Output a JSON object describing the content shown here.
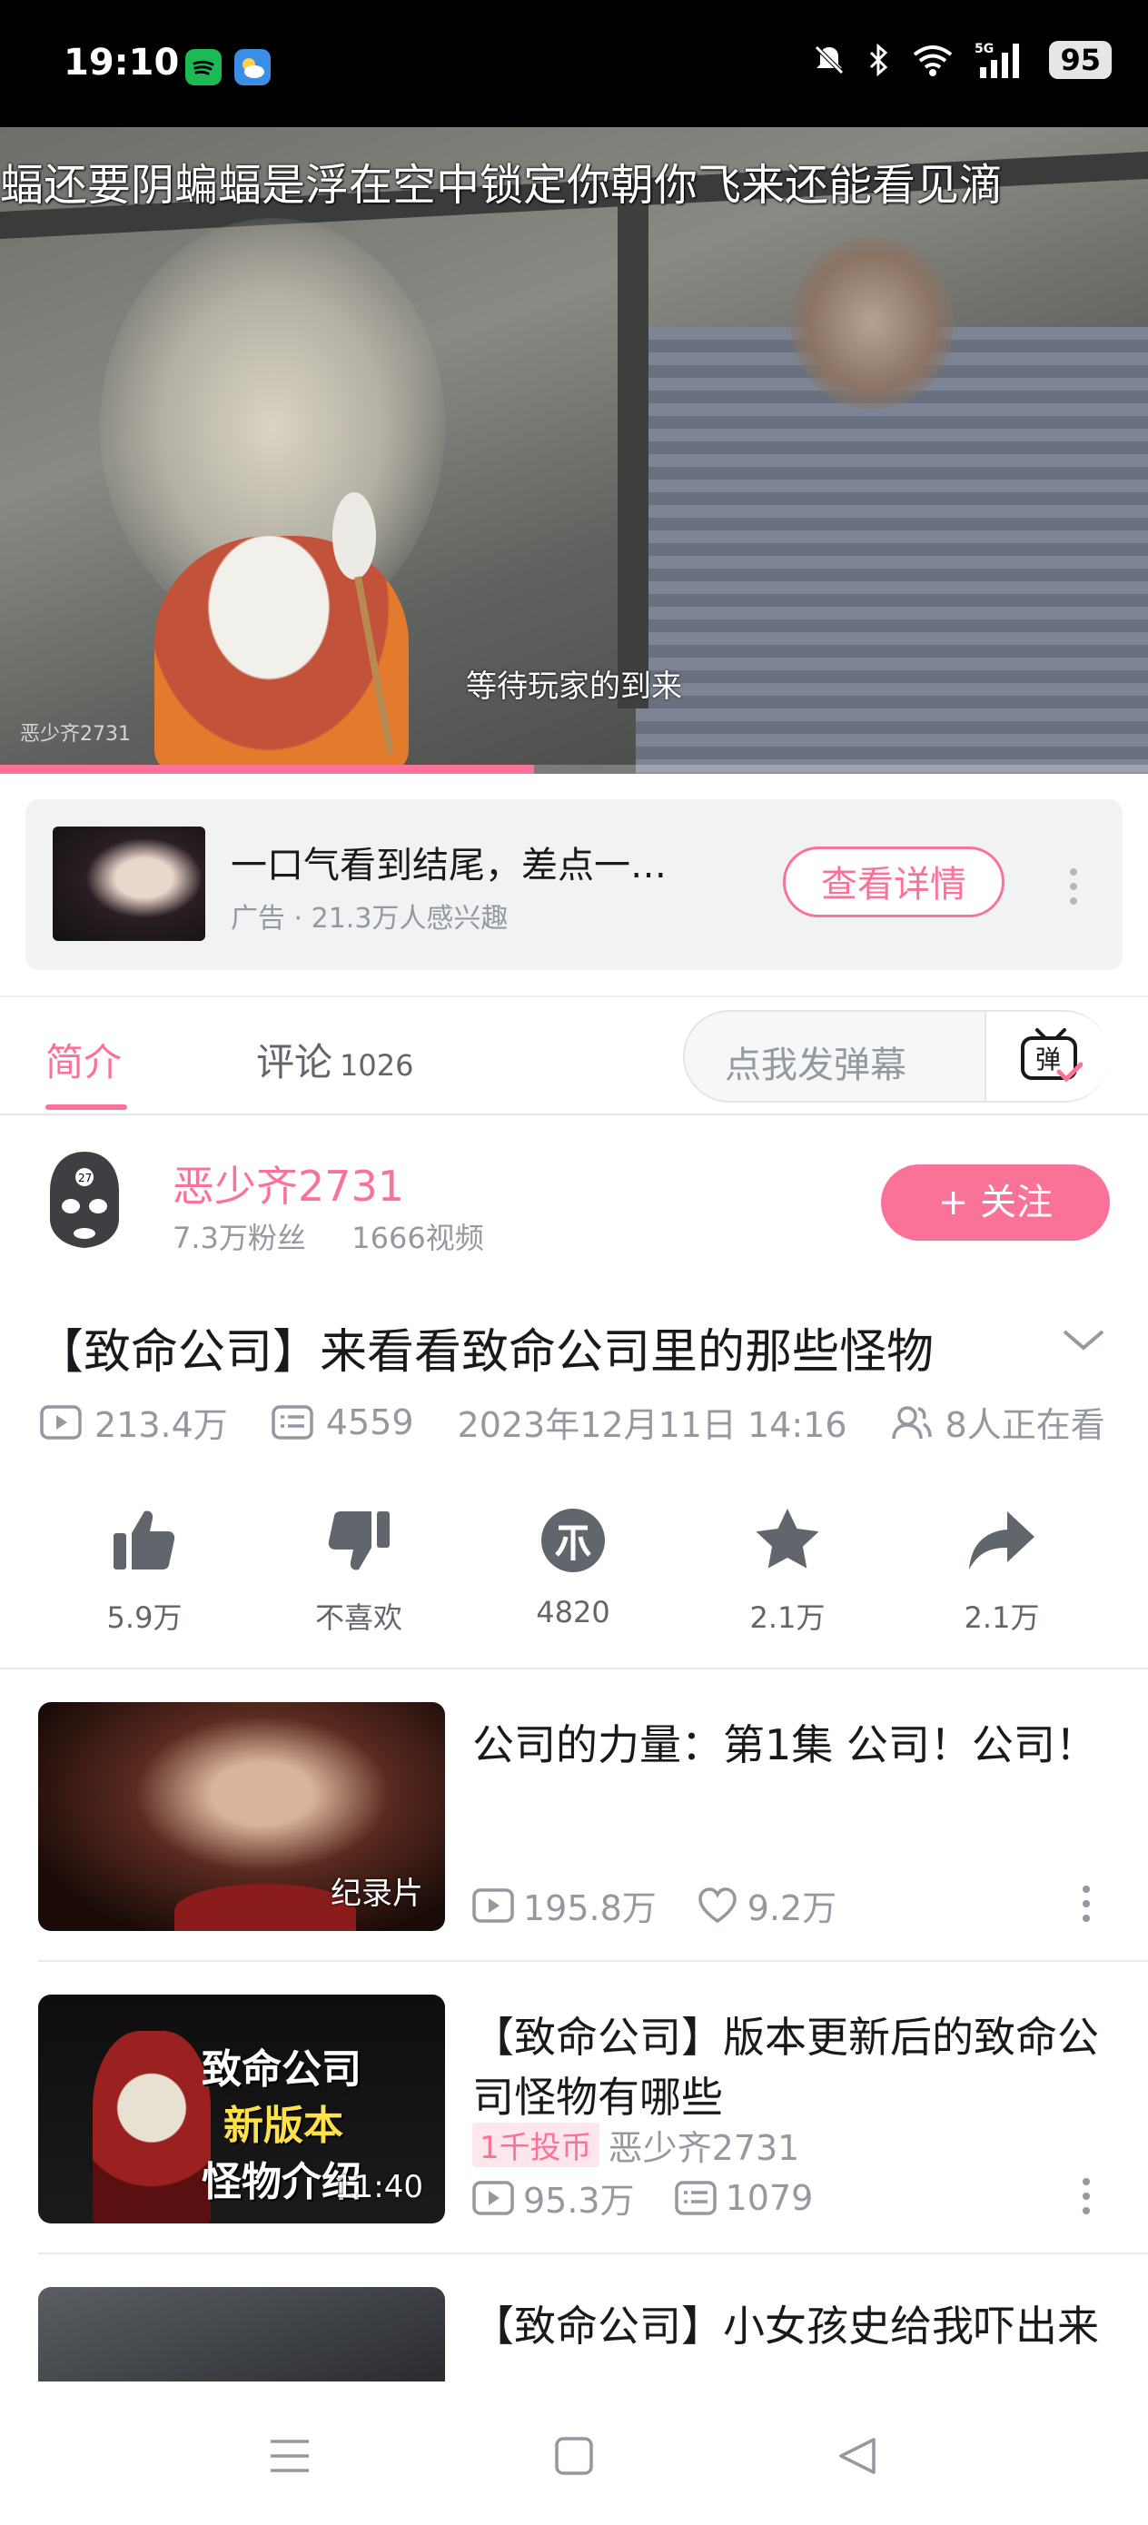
{
  "status_bar": {
    "time": "19:10",
    "battery": "95",
    "network": "5G"
  },
  "video": {
    "danmaku": "蝠还要阴蝙蝠是浮在空中锁定你朝你飞来还能看见滴",
    "subtitle": "等待玩家的到来",
    "watermark": "恶少齐2731",
    "progress": 0.465
  },
  "ad": {
    "title": "一口气看到结尾，差点一…",
    "sub": "广告 · 21.3万人感兴趣",
    "button": "查看详情"
  },
  "tabs": {
    "intro": "简介",
    "comments": "评论",
    "comment_count": "1026",
    "danmaku_placeholder": "点我发弹幕",
    "danmaku_button": "弹"
  },
  "uploader": {
    "name": "恶少齐2731",
    "fans": "7.3万粉丝",
    "videos": "1666视频",
    "follow": "+ 关注"
  },
  "video_info": {
    "title": "【致命公司】来看看致命公司里的那些怪物",
    "views": "213.4万",
    "danmaku_count": "4559",
    "date": "2023年12月11日 14:16",
    "watching": "8人正在看"
  },
  "actions": {
    "like": "5.9万",
    "dislike": "不喜欢",
    "coin": "4820",
    "favorite": "2.1万",
    "share": "2.1万"
  },
  "related": [
    {
      "title": "公司的力量：第1集 公司！公司！",
      "badge": "纪录片",
      "views": "195.8万",
      "likes": "9.2万"
    },
    {
      "title": "【致命公司】版本更新后的致命公司怪物有哪些",
      "thumb_text_1": "致命公司",
      "thumb_text_2": "新版本",
      "thumb_text_3": "怪物介绍",
      "duration": "11:40",
      "coin_tag": "1千投币",
      "author": "恶少齐2731",
      "views": "95.3万",
      "danmaku": "1079"
    },
    {
      "title": "【致命公司】小女孩史给我吓出来"
    }
  ],
  "colors": {
    "accent": "#fb7299",
    "text": "#18191c",
    "muted": "#9499a0"
  }
}
